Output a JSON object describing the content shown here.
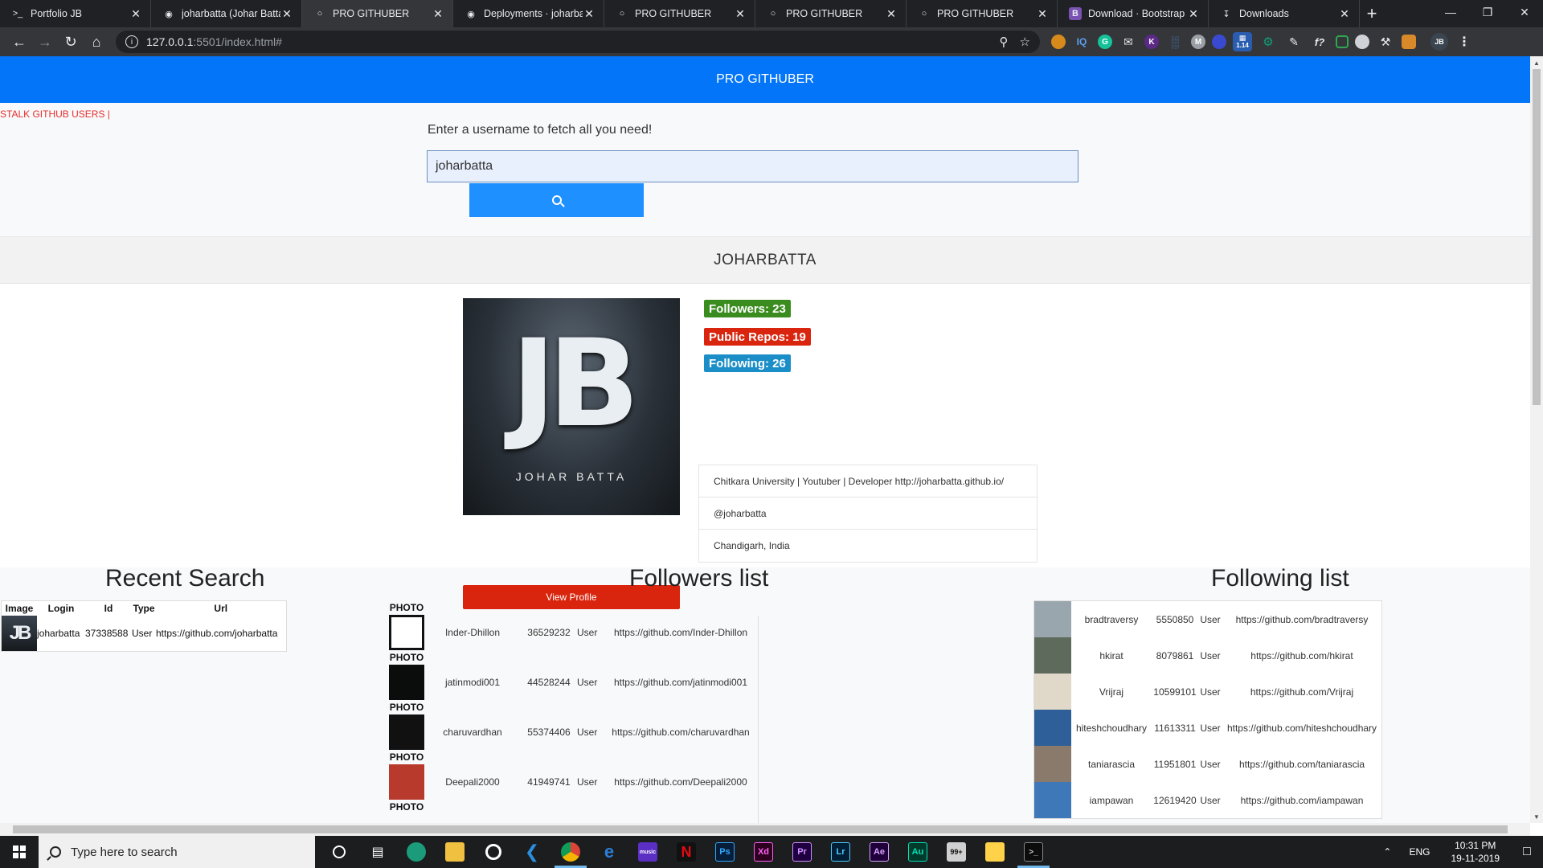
{
  "browser": {
    "tabs": [
      {
        "title": "Portfolio JB",
        "icon": "terminal-icon",
        "active": false
      },
      {
        "title": "joharbatta (Johar Batta)",
        "icon": "github-icon",
        "active": false
      },
      {
        "title": "PRO GITHUBER",
        "icon": "globe-icon",
        "active": true
      },
      {
        "title": "Deployments · joharbat",
        "icon": "github-icon",
        "active": false
      },
      {
        "title": "PRO GITHUBER",
        "icon": "globe-icon",
        "active": false
      },
      {
        "title": "PRO GITHUBER",
        "icon": "globe-icon",
        "active": false
      },
      {
        "title": "PRO GITHUBER",
        "icon": "globe-icon",
        "active": false
      },
      {
        "title": "Download · Bootstrap",
        "icon": "bootstrap-icon",
        "active": false
      },
      {
        "title": "Downloads",
        "icon": "download-icon",
        "active": false
      }
    ],
    "url_host": "127.0.0.1",
    "url_rest": ":5501/index.html#",
    "extension_badge": "1.14"
  },
  "page": {
    "navbar_title": "PRO GITHUBER",
    "brand_link": "STALK GITHUB USERS |",
    "prompt": "Enter a username to fetch all you need!",
    "search_value": "joharbatta",
    "profile": {
      "username": "JOHARBATTA",
      "avatar_text": "JB",
      "avatar_name": "JOHAR BATTA",
      "followers": "Followers: 23",
      "repos": "Public Repos: 19",
      "following": "Following: 26",
      "bio": "Chitkara University | Youtuber | Developer http://joharbatta.github.io/",
      "handle": "@joharbatta",
      "location": "Chandigarh, India",
      "view_profile": "View Profile"
    },
    "recent": {
      "title": "Recent Search",
      "headers": [
        "Image",
        "Login",
        "Id",
        "Type",
        "Url"
      ],
      "rows": [
        {
          "login": "joharbatta",
          "id": "37338588",
          "type": "User",
          "url": "https://github.com/joharbatta"
        }
      ]
    },
    "followers": {
      "title": "Followers list",
      "photo_label": "PHOTO",
      "rows": [
        {
          "login": "Inder-Dhillon",
          "id": "36529232",
          "type": "User",
          "url": "https://github.com/Inder-Dhillon",
          "avatar_color": "#ffffff"
        },
        {
          "login": "jatinmodi001",
          "id": "44528244",
          "type": "User",
          "url": "https://github.com/jatinmodi001",
          "avatar_color": "#0b0d0c"
        },
        {
          "login": "charuvardhan",
          "id": "55374406",
          "type": "User",
          "url": "https://github.com/charuvardhan",
          "avatar_color": "#111111"
        },
        {
          "login": "Deepali2000",
          "id": "41949741",
          "type": "User",
          "url": "https://github.com/Deepali2000",
          "avatar_color": "#b83a2c"
        }
      ]
    },
    "following": {
      "title": "Following list",
      "rows": [
        {
          "login": "bradtraversy",
          "id": "5550850",
          "type": "User",
          "url": "https://github.com/bradtraversy",
          "avatar_color": "#9aa6ae"
        },
        {
          "login": "hkirat",
          "id": "8079861",
          "type": "User",
          "url": "https://github.com/hkirat",
          "avatar_color": "#5d6a5c"
        },
        {
          "login": "Vrijraj",
          "id": "10599101",
          "type": "User",
          "url": "https://github.com/Vrijraj",
          "avatar_color": "#e0d8c8"
        },
        {
          "login": "hiteshchoudhary",
          "id": "11613311",
          "type": "User",
          "url": "https://github.com/hiteshchoudhary",
          "avatar_color": "#2f5f98"
        },
        {
          "login": "taniarascia",
          "id": "11951801",
          "type": "User",
          "url": "https://github.com/taniarascia",
          "avatar_color": "#8a7a6c"
        },
        {
          "login": "iampawan",
          "id": "12619420",
          "type": "User",
          "url": "https://github.com/iampawan",
          "avatar_color": "#3e78b8"
        }
      ]
    }
  },
  "taskbar": {
    "search_placeholder": "Type here to search",
    "lang": "ENG",
    "time": "10:31 PM",
    "date": "19-11-2019",
    "notif_badge": "99+"
  },
  "colors": {
    "navbar": "#0275f8",
    "followers_badge": "#3a8c1e",
    "repos_badge": "#d9250e",
    "following_badge": "#1b8ec8",
    "view_profile": "#d9250e",
    "search_button": "#1e90ff"
  }
}
